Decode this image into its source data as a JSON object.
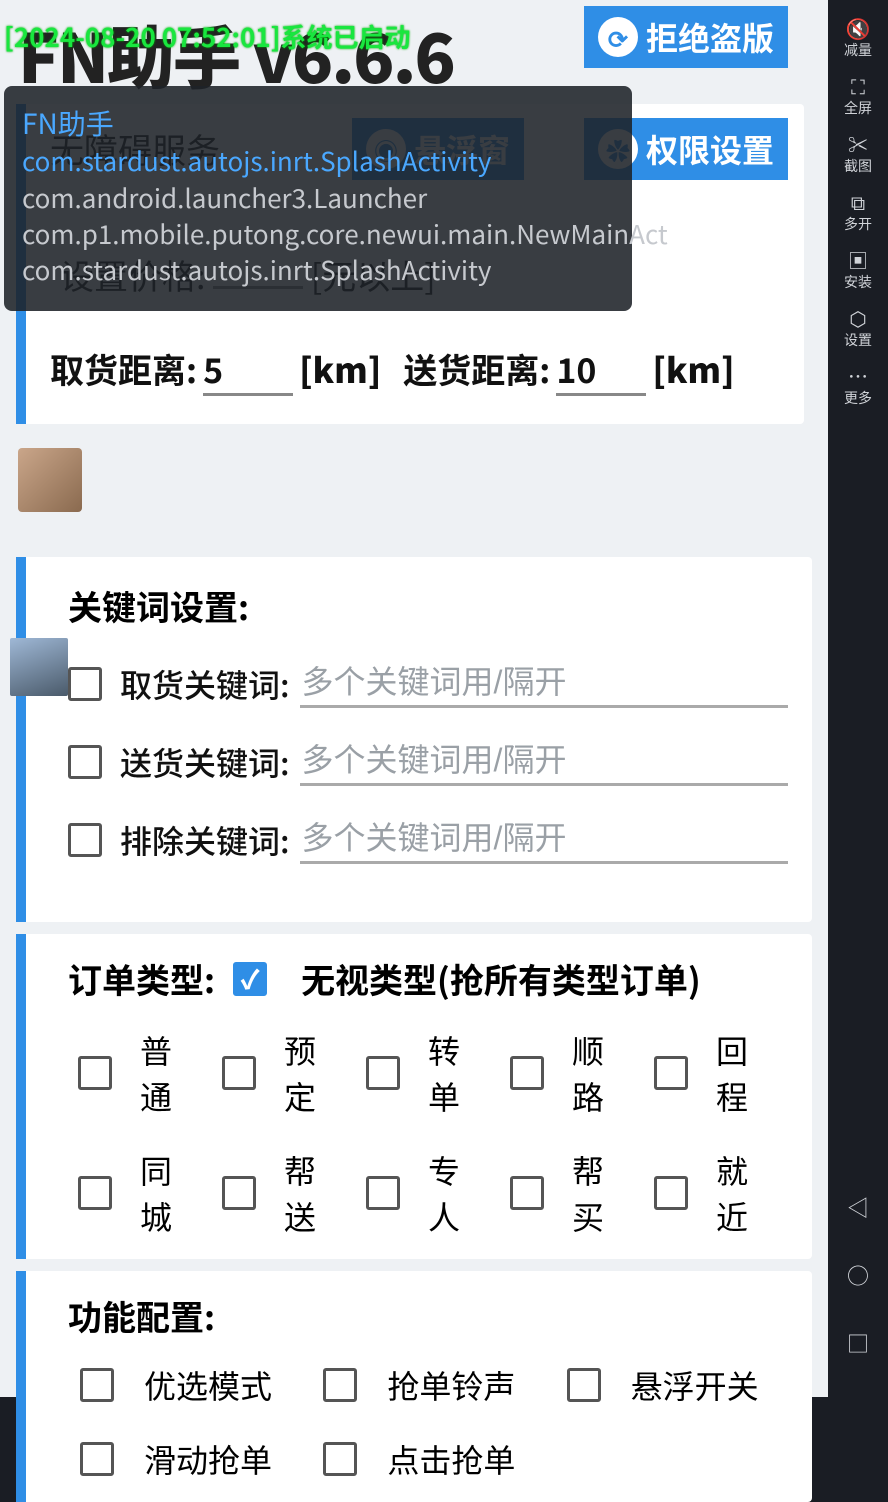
{
  "log_status": "[2024-08-20 07:52:01]系统已启动",
  "app_title": "FN助手  v6.6.6",
  "top_buttons": {
    "refresh": "拒绝盗版",
    "float": "悬浮窗",
    "perm": "权限设置"
  },
  "card1": {
    "row1": "无障碍服务",
    "price_label": "设置价格:",
    "price_unit": "[元以上]",
    "pickup_dist_label": "取货距离:",
    "pickup_dist_value": "5",
    "deliver_dist_label": "送货距离:",
    "deliver_dist_value": "10",
    "unit_km": "[km]"
  },
  "kw": {
    "title": "关键词设置:",
    "pickup_label": "取货关键词:",
    "deliver_label": "送货关键词:",
    "exclude_label": "排除关键词:",
    "placeholder": "多个关键词用/隔开"
  },
  "order_type": {
    "title": "订单类型:",
    "ignore_label": "无视类型(抢所有类型订单)",
    "options": [
      "普通",
      "预定",
      "转单",
      "顺路",
      "回程",
      "同城",
      "帮送",
      "专人",
      "帮买",
      "就近"
    ]
  },
  "fn": {
    "title": "功能配置:",
    "options": [
      "优选模式",
      "抢单铃声",
      "悬浮开关",
      "滑动抢单",
      "点击抢单"
    ]
  },
  "toast": {
    "title": "FN助手",
    "link": "com.stardust.autojs.inrt.SplashActivity",
    "line3": "com.android.launcher3.Launcher",
    "line4": "com.p1.mobile.putong.core.newui.main.NewMainAct",
    "line5": "com.stardust.autojs.inrt.SplashActivity"
  },
  "sidebar": {
    "vol_down": "减量",
    "fullscreen": "全屏",
    "screenshot": "截图",
    "multi": "多开",
    "install": "安装",
    "settings": "设置",
    "more": "更多"
  }
}
